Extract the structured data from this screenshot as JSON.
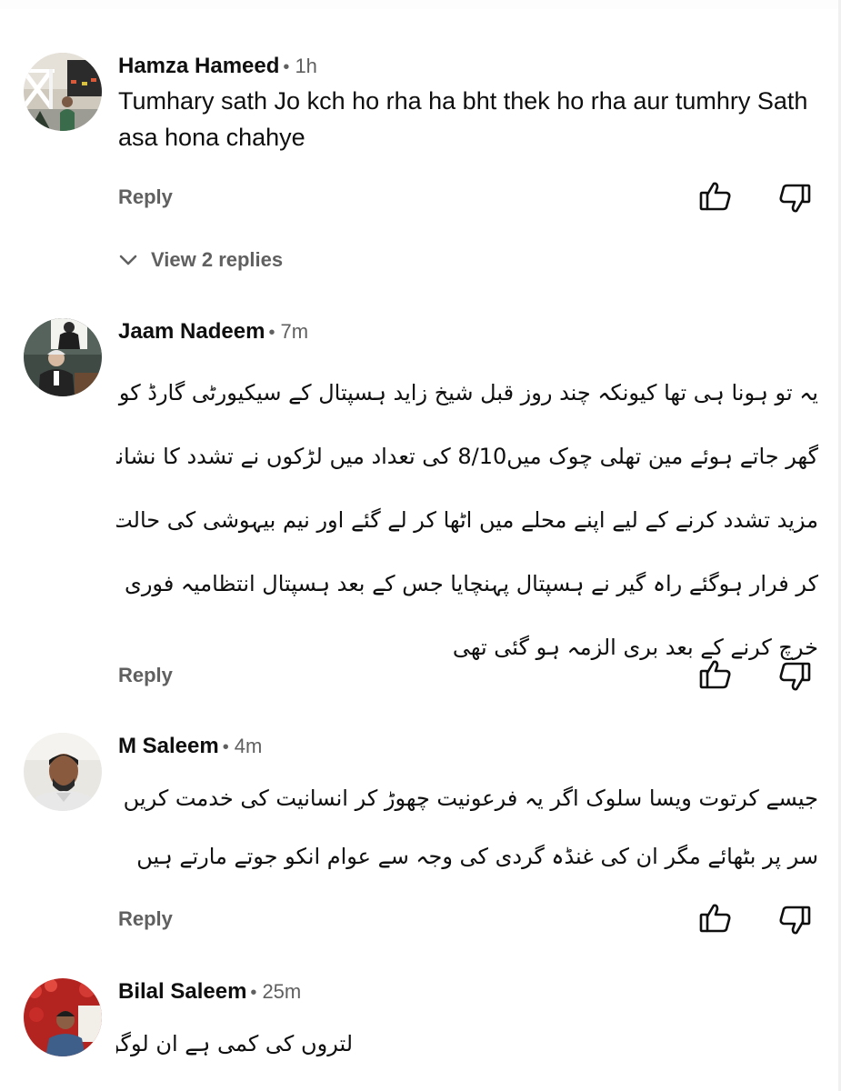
{
  "comments": [
    {
      "author": "Hamza Hameed",
      "dot": "•",
      "time": "1h",
      "text": "Tumhary sath Jo kch ho rha ha bht thek ho rha aur tumhry Sath asa hona chahye",
      "reply_label": "Reply",
      "view_replies_label": "View 2 replies"
    },
    {
      "author": "Jaam Nadeem",
      "dot": "•",
      "time": "7m",
      "lines": [
        "یہ تو ہونا ہی تھا کیونکہ چند روز قبل شیخ زاید ہسپتال کے سیکیورٹی گارڈ کو ڈیوٹی مکمل کر کے",
        "گھر جاتے ہوئے مین تھلی چوک میں8/10 کی تعداد میں لڑکوں نے تشدد کا نشانہ بنایا پھر",
        "مزید تشدد کرنے کے لیے اپنے محلے میں اٹھا کر لے گئے اور نیم بیہوشی کی حالت میں چھوڑ",
        "کر فرار ہوگئے راہ گیر نے ہسپتال پہنچایا جس کے بعد ہسپتال انتظامیہ فوری طور پر زبانی جمع",
        "خرچ کرنے کے بعد بری الزمہ ہو گئی تھی"
      ],
      "reply_label": "Reply"
    },
    {
      "author": "M Saleem",
      "dot": "•",
      "time": "4m",
      "lines": [
        "جیسے کرتوت ویسا سلوک اگر یہ فرعونیت چھوڑ کر انسانیت کی خدمت کریں تو لوگ ان کو",
        "سر پر بٹھائے مگر ان کی غنڈہ گردی کی وجہ سے عوام انکو جوتے مارتے ہیں"
      ],
      "reply_label": "Reply"
    },
    {
      "author": "Bilal Saleem",
      "dot": "•",
      "time": "25m",
      "lines": [
        "لتروں کی کمی ہے ان لوگوں کو"
      ]
    }
  ],
  "colors": {
    "primary_text": "#0f0f0f",
    "secondary_text": "#606060",
    "icon": "#0f0f0f",
    "background": "#ffffff"
  },
  "icons": {
    "like": "thumbs-up-outline-icon",
    "dislike": "thumbs-down-outline-icon",
    "expand": "chevron-down-icon"
  }
}
